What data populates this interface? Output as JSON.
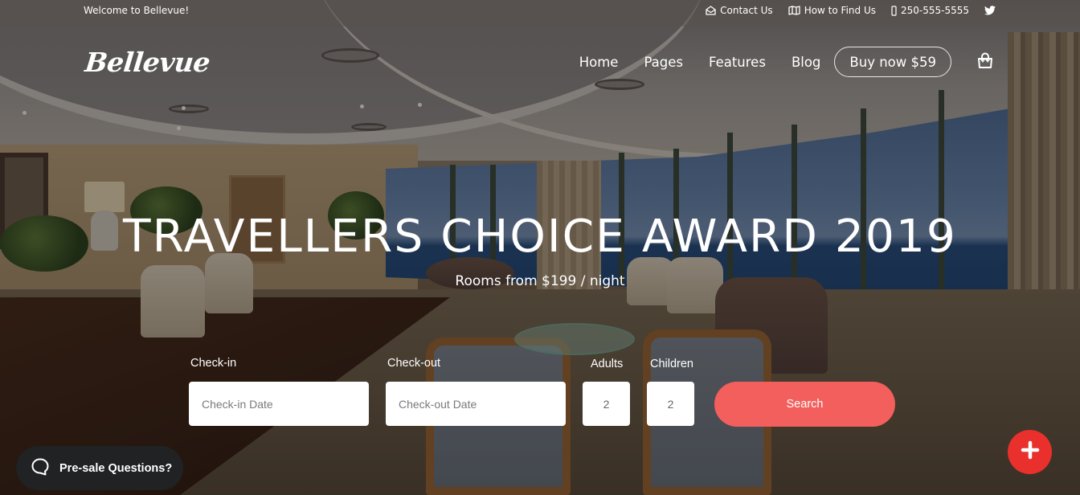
{
  "topbar": {
    "welcome": "Welcome to Bellevue!",
    "links": [
      {
        "icon": "envelope-open-icon",
        "label": "Contact Us"
      },
      {
        "icon": "map-icon",
        "label": "How to Find Us"
      },
      {
        "icon": "phone-icon",
        "label": "250-555-5555"
      },
      {
        "icon": "twitter-icon",
        "label": ""
      }
    ]
  },
  "header": {
    "logo": "Bellevue",
    "nav": [
      {
        "label": "Home"
      },
      {
        "label": "Pages"
      },
      {
        "label": "Features"
      },
      {
        "label": "Blog"
      }
    ],
    "buy_button": "Buy now $59",
    "cart_icon": "shopping-bag-icon"
  },
  "hero": {
    "title": "TRAVELLERS CHOICE AWARD 2019",
    "subtitle": "Rooms from $199 / night"
  },
  "booking": {
    "checkin": {
      "label": "Check-in",
      "placeholder": "Check-in Date",
      "value": ""
    },
    "checkout": {
      "label": "Check-out",
      "placeholder": "Check-out Date",
      "value": ""
    },
    "adults": {
      "label": "Adults",
      "value": "2"
    },
    "children": {
      "label": "Children",
      "value": "2"
    },
    "search_label": "Search",
    "accent_color": "#f25f5c"
  },
  "floating": {
    "presale_label": "Pre-sale Questions?",
    "presale_icon": "chat-bubble-icon",
    "fab_icon": "plus-icon",
    "fab_color": "#e9302d"
  }
}
